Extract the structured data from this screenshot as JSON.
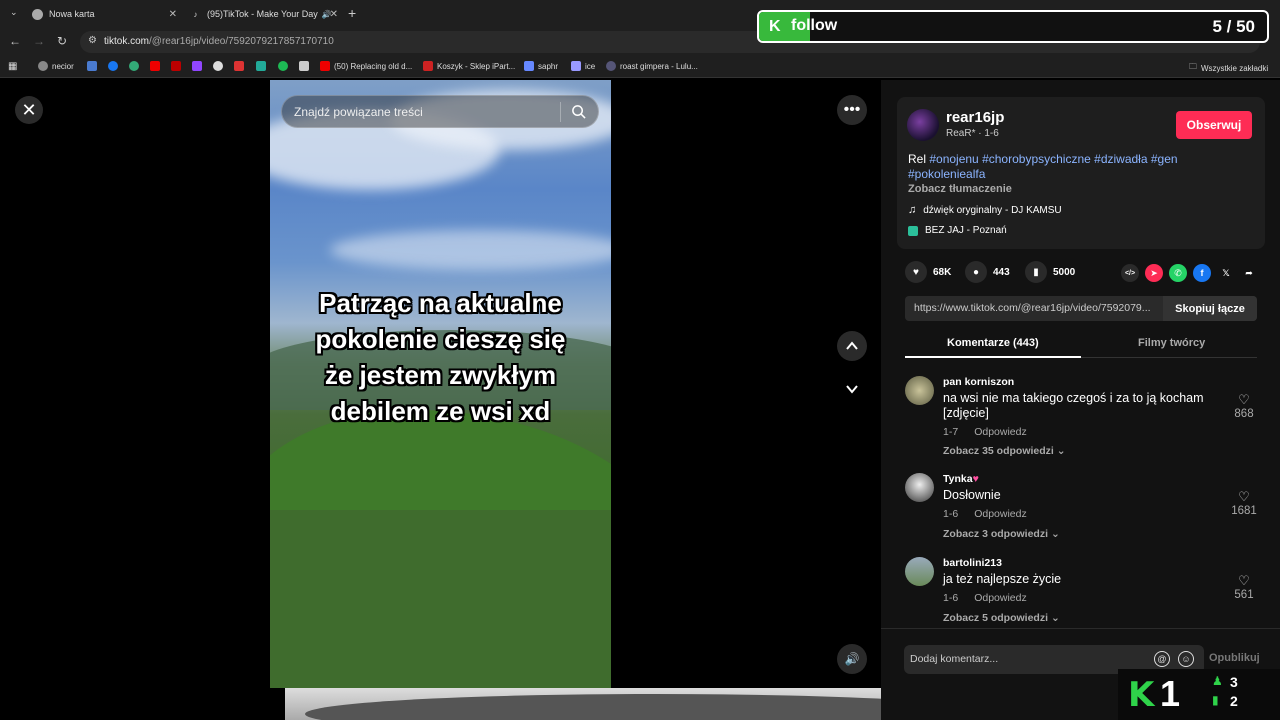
{
  "browser": {
    "tabs": [
      {
        "label": "Nowa karta"
      },
      {
        "label": "(95)TikTok - Make Your Day"
      }
    ],
    "url_domain": "tiktok.com",
    "url_path": "/@rear16jp/video/7592079217857170710",
    "bookmarks": [
      {
        "label": "necior"
      },
      {
        "label": "(50) Replacing old d..."
      },
      {
        "label": "Koszyk - Sklep iPart..."
      },
      {
        "label": "saphr"
      },
      {
        "label": "ice"
      },
      {
        "label": "roast gimpera - Lulu..."
      }
    ],
    "all_bookmarks_label": "Wszystkie zakładki"
  },
  "follow_overlay": {
    "label": "follow",
    "count": "5 / 50",
    "progress": 0.1,
    "color": "#38b93c"
  },
  "video": {
    "search_placeholder": "Znajdź powiązane treści",
    "caption_lines": [
      "Patrząc na aktualne",
      "pokolenie cieszę się",
      "że jestem zwykłym",
      "debilem ze wsi xd"
    ]
  },
  "creator": {
    "username": "rear16jp",
    "subline": "ReaR* · 1-6",
    "follow_label": "Obserwuj",
    "description_prefix": "Rel ",
    "hashtags": [
      "#onojenu",
      "#chorobypsychiczne",
      "#dziwadła",
      "#gen",
      "#pokoleniealfa"
    ],
    "translate_label": "Zobacz tłumaczenie",
    "music": "dźwięk oryginalny - DJ KAMSU",
    "place": "BEZ JAJ - Poznań"
  },
  "stats": {
    "likes": "68K",
    "comments": "443",
    "saves": "5000"
  },
  "share_icons": [
    "embed-icon",
    "paper-plane-icon",
    "whatsapp-icon",
    "facebook-icon",
    "x-icon",
    "share-arrow-icon"
  ],
  "link": {
    "url": "https://www.tiktok.com/@rear16jp/video/7592079...",
    "copy_label": "Skopiuj łącze"
  },
  "panel_tabs": {
    "comments": "Komentarze (443)",
    "creator_videos": "Filmy twórcy"
  },
  "comments": [
    {
      "user": "pan korniszon",
      "text": "na wsi nie ma takiego czegoś i za to ją kocham [zdjęcie]",
      "date": "1-7",
      "reply_label": "Odpowiedz",
      "view_replies": "Zobacz 35 odpowiedzi",
      "likes": "868"
    },
    {
      "user": "Tynka",
      "text": "Dosłownie",
      "date": "1-6",
      "reply_label": "Odpowiedz",
      "view_replies": "Zobacz 3 odpowiedzi",
      "likes": "1681"
    },
    {
      "user": "bartolini213",
      "text": "ja też najlepsze życie",
      "date": "1-6",
      "reply_label": "Odpowiedz",
      "view_replies": "Zobacz 5 odpowiedzi",
      "likes": "561"
    }
  ],
  "comment_input": {
    "placeholder": "Dodaj komentarz...",
    "publish_label": "Opublikuj"
  },
  "score_widget": {
    "main": "1",
    "top": "3",
    "bottom": "2"
  }
}
